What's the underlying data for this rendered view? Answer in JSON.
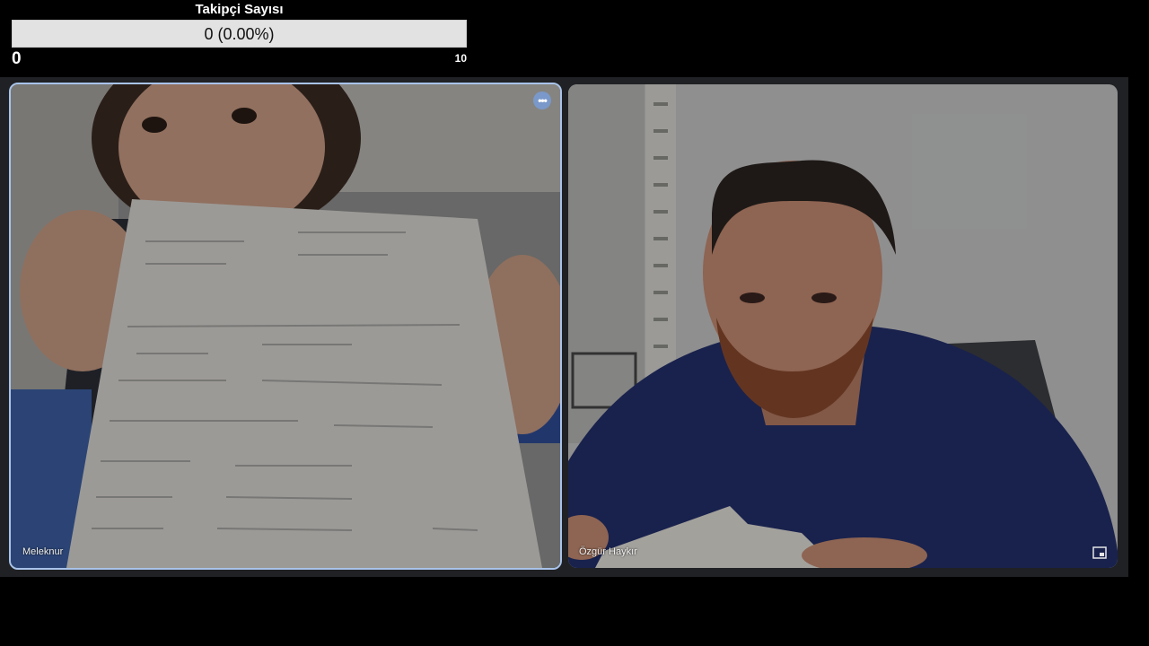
{
  "follower": {
    "title": "Takipçi Sayısı",
    "value_text": "0 (0.00%)",
    "progress": 0,
    "min_label": "0",
    "max_label": "10"
  },
  "participants": [
    {
      "name": "Meleknur"
    },
    {
      "name": "Özgür Haykır"
    }
  ],
  "icons": {
    "more": "more-options-icon",
    "pip": "picture-in-picture-icon"
  },
  "colors": {
    "stage_bg": "#202124",
    "active_border": "#a9c3ea",
    "bar_bg": "#e2e2e2"
  }
}
